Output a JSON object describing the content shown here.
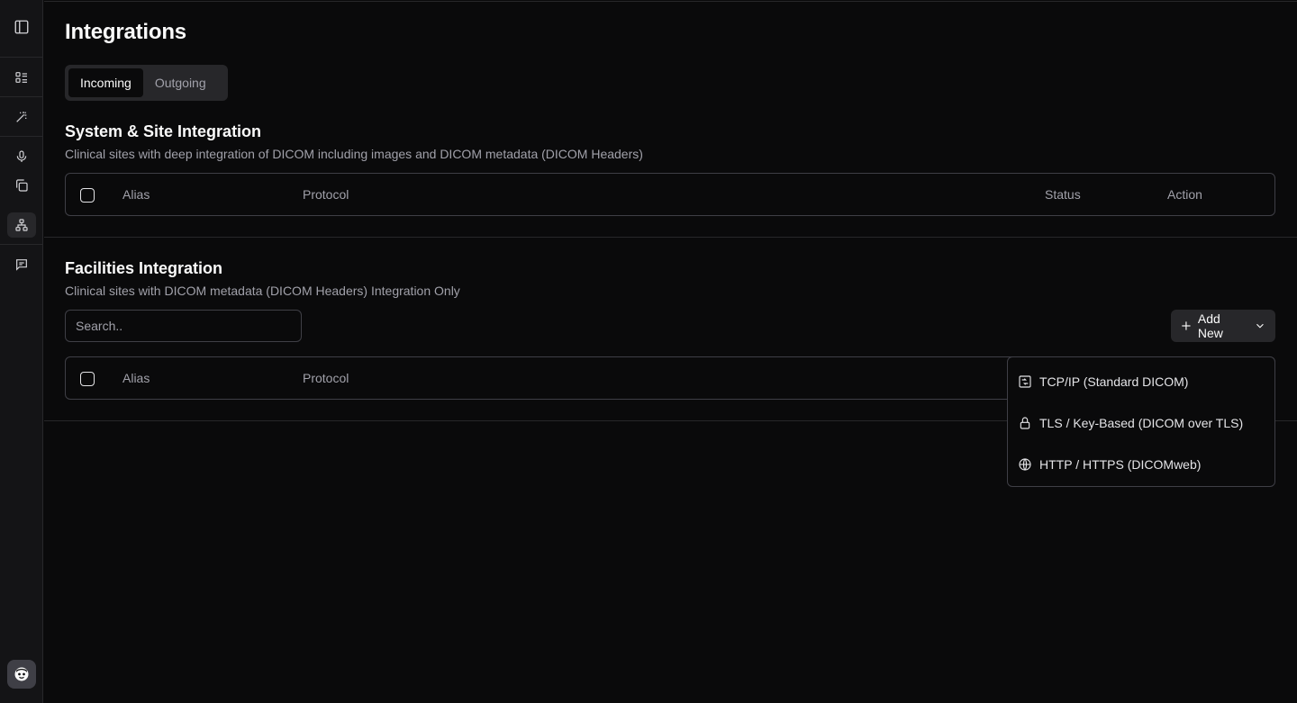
{
  "page": {
    "title": "Integrations"
  },
  "tabs": [
    {
      "label": "Incoming",
      "active": true
    },
    {
      "label": "Outgoing",
      "active": false
    }
  ],
  "sidebar": {
    "items": [
      {
        "icon": "sidebar-toggle-icon"
      },
      {
        "icon": "list-icon"
      },
      {
        "icon": "magic-wand-icon"
      },
      {
        "icon": "microphone-icon"
      },
      {
        "icon": "copy-icon"
      },
      {
        "icon": "network-icon",
        "active": true
      },
      {
        "icon": "message-icon"
      }
    ],
    "avatar": "avatar-icon"
  },
  "system_section": {
    "title": "System & Site Integration",
    "description": "Clinical sites with deep integration of DICOM including images and DICOM metadata (DICOM Headers)",
    "columns": [
      "Alias",
      "Protocol",
      "Status",
      "Action"
    ]
  },
  "facilities_section": {
    "title": "Facilities Integration",
    "description": "Clinical sites with DICOM metadata (DICOM Headers) Integration Only",
    "search_placeholder": "Search..",
    "add_button": "Add New",
    "columns": [
      "Alias",
      "Protocol"
    ]
  },
  "dropdown": {
    "items": [
      {
        "label": "TCP/IP (Standard DICOM)",
        "icon": "tcp-icon"
      },
      {
        "label": "TLS / Key-Based (DICOM over TLS)",
        "icon": "lock-icon"
      },
      {
        "label": "HTTP / HTTPS (DICOMweb)",
        "icon": "globe-icon"
      }
    ]
  },
  "colors": {
    "background": "#0a0a0b",
    "sidebar": "#141416",
    "border": "#3f3f46",
    "muted_text": "#a1a1aa"
  }
}
